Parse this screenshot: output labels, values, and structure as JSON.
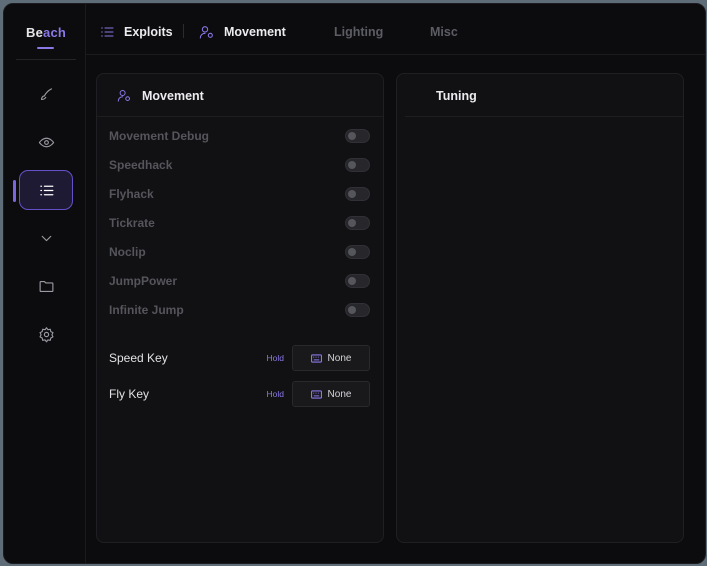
{
  "app": {
    "logo_a": "Be",
    "logo_b": "ach"
  },
  "sidebar": {
    "items": [
      {
        "icon": "brush-icon"
      },
      {
        "icon": "eye-icon"
      },
      {
        "icon": "list-icon",
        "active": true
      },
      {
        "icon": "chevron-down-icon"
      },
      {
        "icon": "folder-icon"
      },
      {
        "icon": "gear-icon"
      }
    ]
  },
  "tabs": [
    {
      "label": "Exploits",
      "icon": "list-icon",
      "state": "active"
    },
    {
      "label": "Movement",
      "icon": "user-settings-icon",
      "state": "active"
    },
    {
      "label": "Lighting",
      "state": "inactive"
    },
    {
      "label": "Misc",
      "state": "inactive"
    }
  ],
  "movement_panel": {
    "title": "Movement",
    "toggles": [
      {
        "label": "Movement Debug",
        "enabled": false
      },
      {
        "label": "Speedhack",
        "enabled": false
      },
      {
        "label": "Flyhack",
        "enabled": false
      },
      {
        "label": "Tickrate",
        "enabled": false
      },
      {
        "label": "Noclip",
        "enabled": false
      },
      {
        "label": "JumpPower",
        "enabled": false
      },
      {
        "label": "Infinite Jump",
        "enabled": false
      }
    ],
    "keybinds": [
      {
        "label": "Speed Key",
        "mode": "Hold",
        "value": "None"
      },
      {
        "label": "Fly Key",
        "mode": "Hold",
        "value": "None"
      }
    ]
  },
  "tuning_panel": {
    "title": "Tuning"
  },
  "colors": {
    "accent": "#8a78e6",
    "background": "#0c0c0e",
    "panel": "#111113"
  }
}
